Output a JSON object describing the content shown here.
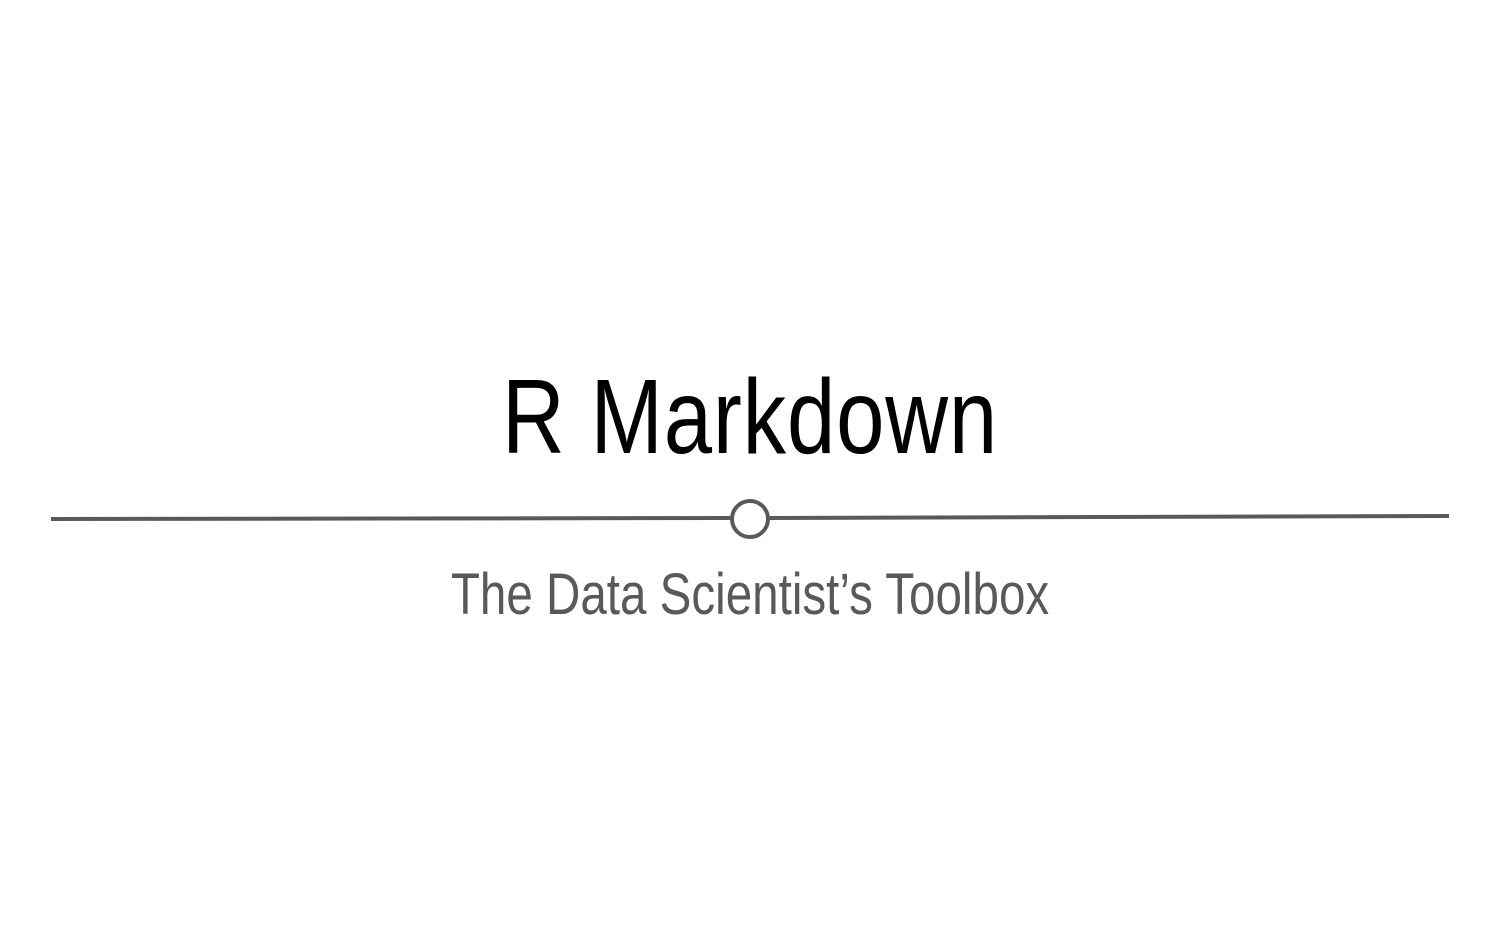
{
  "slide": {
    "title": "R Markdown",
    "subtitle": "The Data Scientist’s Toolbox",
    "colors": {
      "background": "#ffffff",
      "title": "#000000",
      "subtitle": "#595959",
      "divider": "#595959"
    }
  }
}
